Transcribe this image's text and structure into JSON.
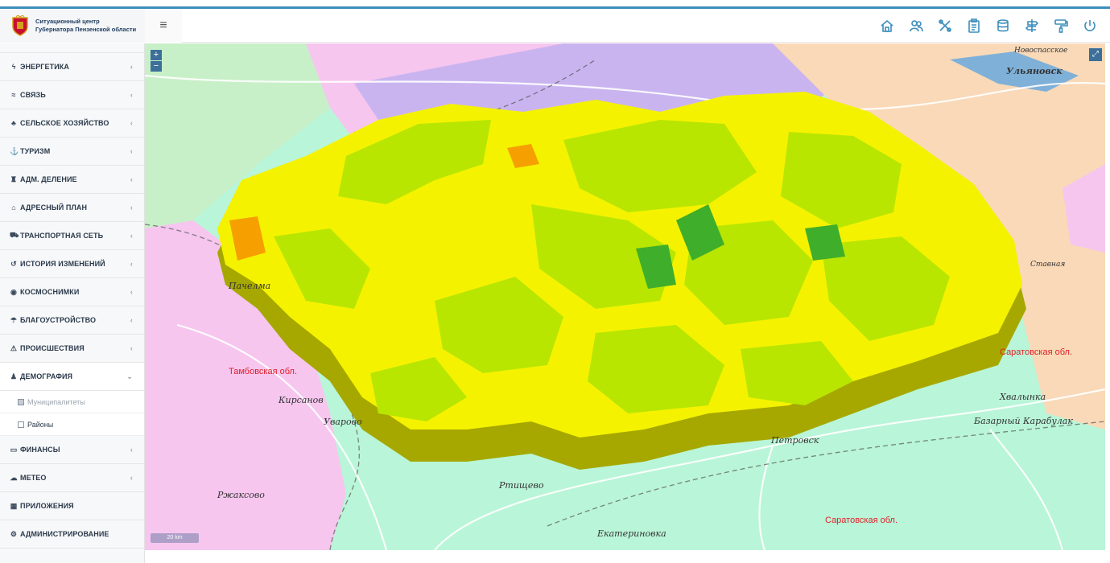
{
  "header": {
    "title_line1": "Ситуационный центр",
    "title_line2": "Губернатора Пензенской области",
    "menu_toggle": "≡",
    "tools": [
      "home-icon",
      "users-icon",
      "tools-icon",
      "clipboard-icon",
      "database-icon",
      "signpost-icon",
      "paint-roller-icon",
      "power-icon"
    ]
  },
  "sidebar": {
    "items": [
      {
        "icon": "ϟ",
        "label": "ЭНЕРГЕТИКА",
        "chevron": "‹"
      },
      {
        "icon": "≈",
        "label": "СВЯЗЬ",
        "chevron": "‹"
      },
      {
        "icon": "♣",
        "label": "СЕЛЬСКОЕ ХОЗЯЙСТВО",
        "chevron": "‹"
      },
      {
        "icon": "⚓",
        "label": "ТУРИЗМ",
        "chevron": "‹"
      },
      {
        "icon": "♜",
        "label": "АДМ. ДЕЛЕНИЕ",
        "chevron": "‹"
      },
      {
        "icon": "⌂",
        "label": "АДРЕСНЫЙ ПЛАН",
        "chevron": "‹"
      },
      {
        "icon": "⛟",
        "label": "ТРАНСПОРТНАЯ СЕТЬ",
        "chevron": "‹"
      },
      {
        "icon": "↺",
        "label": "ИСТОРИЯ ИЗМЕНЕНИЙ",
        "chevron": "‹"
      },
      {
        "icon": "◉",
        "label": "КОСМОСНИМКИ",
        "chevron": "‹"
      },
      {
        "icon": "☂",
        "label": "БЛАГОУСТРОЙСТВО",
        "chevron": "‹"
      },
      {
        "icon": "⚠",
        "label": "ПРОИСШЕСТВИЯ",
        "chevron": "‹"
      }
    ],
    "demography": {
      "icon": "♟",
      "label": "ДЕМОГРАФИЯ",
      "chevron": "⌄",
      "sub": [
        {
          "label": "Муниципалитеты",
          "checked": true
        },
        {
          "label": "Районы",
          "checked": false
        }
      ]
    },
    "items_after": [
      {
        "icon": "▭",
        "label": "ФИНАНСЫ",
        "chevron": "‹"
      },
      {
        "icon": "☁",
        "label": "МЕТЕО",
        "chevron": "‹"
      },
      {
        "icon": "▦",
        "label": "ПРИЛОЖЕНИЯ",
        "chevron": ""
      },
      {
        "icon": "⚙",
        "label": "АДМИНИСТРИРОВАНИЕ",
        "chevron": ""
      }
    ]
  },
  "map": {
    "zoom_in": "+",
    "zoom_out": "−",
    "fullscreen": "⤢",
    "scale": "20 km",
    "labels": [
      {
        "text": "Тамбовская обл.",
        "red": true
      },
      {
        "text": "Саратовская обл.",
        "red": true
      },
      {
        "text": "Саратовская обл.",
        "red": true
      },
      {
        "text": "Ульяновск",
        "red": false
      },
      {
        "text": "Пачелма",
        "red": false
      },
      {
        "text": "Кирсанов",
        "red": false
      },
      {
        "text": "Уварово",
        "red": false
      },
      {
        "text": "Ртищево",
        "red": false
      },
      {
        "text": "Ржаксово",
        "red": false
      },
      {
        "text": "Екатериновка",
        "red": false
      },
      {
        "text": "Петровск",
        "red": false
      },
      {
        "text": "Хвалынка",
        "red": false
      },
      {
        "text": "Базарный Карабулак",
        "red": false
      },
      {
        "text": "Ставная",
        "red": false
      },
      {
        "text": "Новоспасское",
        "red": false
      }
    ]
  },
  "colors": {
    "accent": "#3c8dbc",
    "choropleth_yellow": "#f5f200",
    "choropleth_lightgreen": "#b8e600",
    "choropleth_green": "#3fae2a",
    "choropleth_orange": "#f5a000"
  }
}
